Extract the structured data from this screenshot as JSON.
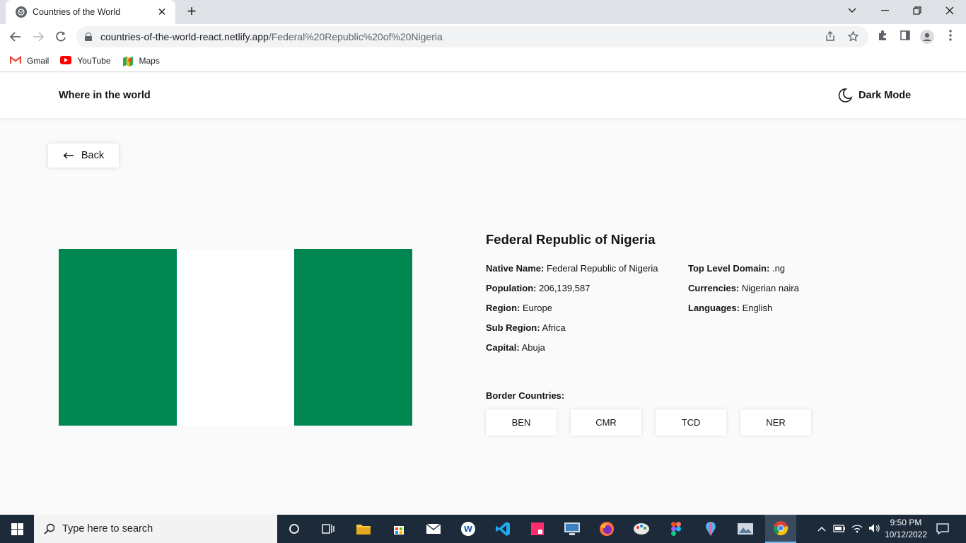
{
  "browser": {
    "tab_title": "Countries of the World",
    "tab_close": "✕",
    "new_tab": "+",
    "url_host": "countries-of-the-world-react.netlify.app",
    "url_path": "/Federal%20Republic%20of%20Nigeria",
    "bookmarks": [
      {
        "label": "Gmail",
        "icon": "gmail-icon"
      },
      {
        "label": "YouTube",
        "icon": "youtube-icon"
      },
      {
        "label": "Maps",
        "icon": "maps-icon"
      }
    ]
  },
  "app": {
    "title": "Where in the world",
    "dark_mode_label": "Dark Mode",
    "back_label": "Back"
  },
  "country": {
    "name": "Federal Republic of Nigeria",
    "flag_colors": [
      "#008751",
      "#ffffff",
      "#008751"
    ],
    "left_fields": [
      {
        "label": "Native Name:",
        "value": "Federal Republic of Nigeria"
      },
      {
        "label": "Population:",
        "value": "206,139,587"
      },
      {
        "label": "Region:",
        "value": "Europe"
      },
      {
        "label": "Sub Region:",
        "value": "Africa"
      },
      {
        "label": "Capital:",
        "value": "Abuja"
      }
    ],
    "right_fields": [
      {
        "label": "Top Level Domain:",
        "value": ".ng"
      },
      {
        "label": "Currencies:",
        "value": "Nigerian naira"
      },
      {
        "label": "Languages:",
        "value": "English"
      }
    ],
    "border_label": "Border Countries:",
    "borders": [
      "BEN",
      "CMR",
      "TCD",
      "NER"
    ]
  },
  "taskbar": {
    "search_placeholder": "Type here to search",
    "time": "9:50 PM",
    "date": "10/12/2022"
  },
  "colors": {
    "flag_green": "#008751",
    "taskbar_bg": "#1c2a3a",
    "page_bg": "#fafafa"
  }
}
